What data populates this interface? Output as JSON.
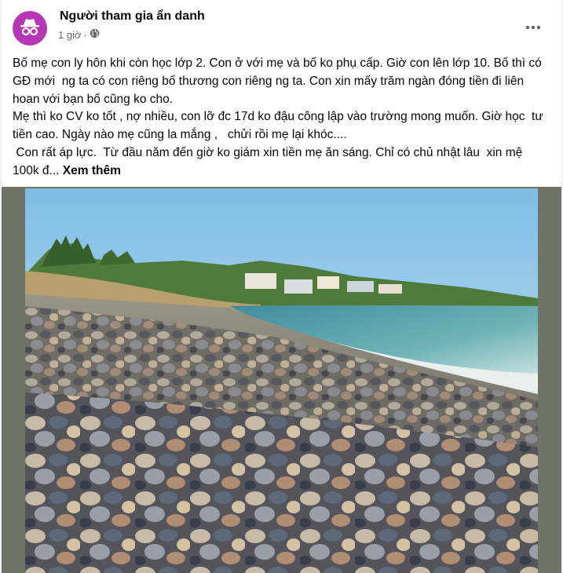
{
  "post": {
    "author": "Người tham gia ẩn danh",
    "time": "1 giờ",
    "privacy_icon": "globe-icon",
    "avatar_icon": "incognito-icon",
    "more_icon": "more-horizontal-icon",
    "body_lines": [
      "Bố mẹ con ly hôn khi còn học lớp 2. Con ở với mẹ và bố ko phụ cấp. Giờ con lên lớp 10. Bố thì có GĐ mới  ng ta có con riêng bố thương con riêng ng ta. Con xin mấy trăm ngàn đóng tiền đi liên hoan với bạn bố cũng ko cho.",
      "Mẹ thì ko CV ko tốt , nợ nhiều, con lỡ đc 17d ko đậu công lập vào trường mong muốn. Giờ học  tư tiền cao. Ngày nào mẹ cũng la mắng ,   chửi rồi mẹ lại khóc....",
      " Con rất áp lực.  Từ đầu năm đến giờ ko giám xin tiền mẹ ăn sáng. Chỉ có chủ nhật lâu  xin mệ 100k đ... "
    ],
    "see_more": "Xem thêm",
    "colors": {
      "avatar_bg": "#b637b6",
      "meta_text": "#65676b"
    }
  }
}
